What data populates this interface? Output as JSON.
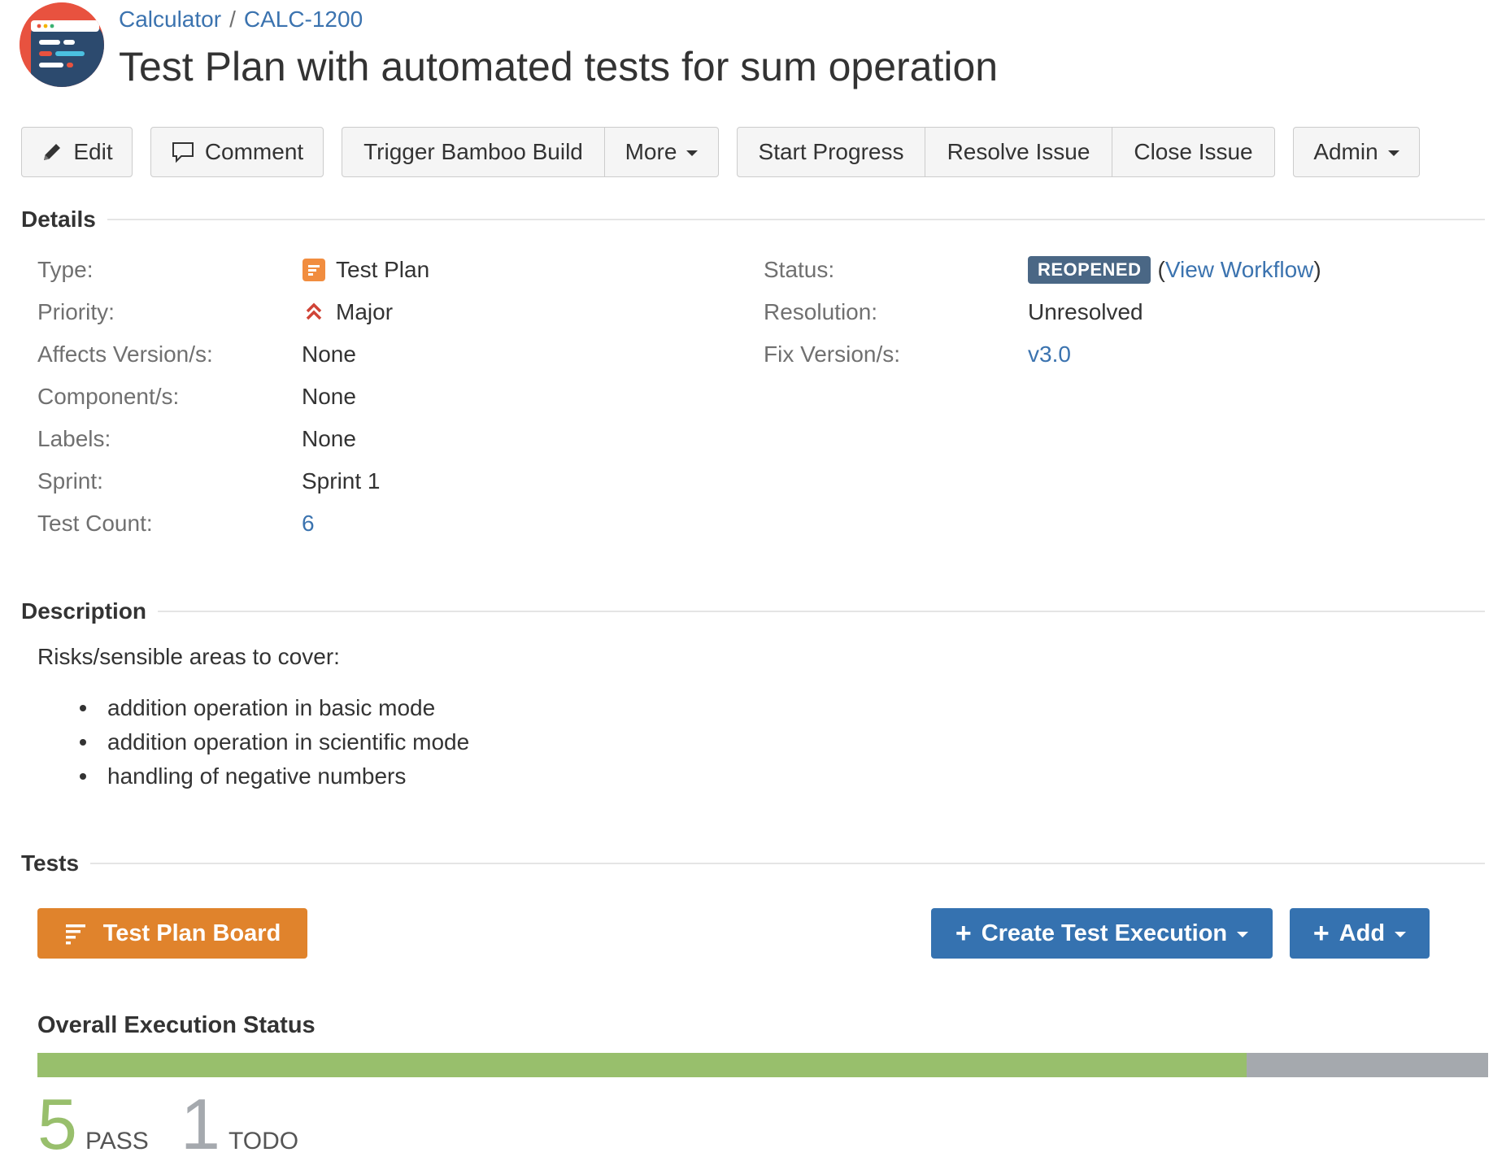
{
  "breadcrumb": {
    "project": "Calculator",
    "separator": "/",
    "issue_key": "CALC-1200"
  },
  "title": "Test Plan with automated tests for sum operation",
  "toolbar": {
    "edit": "Edit",
    "comment": "Comment",
    "trigger_bamboo": "Trigger Bamboo Build",
    "more": "More",
    "start_progress": "Start Progress",
    "resolve_issue": "Resolve Issue",
    "close_issue": "Close Issue",
    "admin": "Admin"
  },
  "details": {
    "heading": "Details",
    "type": {
      "label": "Type:",
      "value": "Test Plan"
    },
    "priority": {
      "label": "Priority:",
      "value": "Major"
    },
    "affects_versions": {
      "label": "Affects Version/s:",
      "value": "None"
    },
    "components": {
      "label": "Component/s:",
      "value": "None"
    },
    "labels": {
      "label": "Labels:",
      "value": "None"
    },
    "sprint": {
      "label": "Sprint:",
      "value": "Sprint 1"
    },
    "test_count": {
      "label": "Test Count:",
      "value": "6"
    },
    "status": {
      "label": "Status:",
      "value": "REOPENED",
      "open_paren": "(",
      "workflow_link": "View Workflow",
      "close_paren": ")"
    },
    "resolution": {
      "label": "Resolution:",
      "value": "Unresolved"
    },
    "fix_versions": {
      "label": "Fix Version/s:",
      "value": "v3.0"
    }
  },
  "description": {
    "heading": "Description",
    "intro": "Risks/sensible areas to cover:",
    "items": [
      "addition operation in basic mode",
      "addition operation in scientific mode",
      "handling of negative numbers"
    ]
  },
  "tests": {
    "heading": "Tests",
    "board_button": "Test Plan Board",
    "create_execution_button": "Create Test Execution",
    "add_button": "Add",
    "overall_title": "Overall Execution Status",
    "pass_count": "5",
    "pass_label": "PASS",
    "todo_count": "1",
    "todo_label": "TODO",
    "pass_fraction": 0.8333
  },
  "colors": {
    "link": "#3b73af",
    "badge_reopened": "#4a6785",
    "board_button": "#e0832c",
    "primary_button": "#3572b0",
    "pass": "#98bf6c",
    "todo": "#a5a9ae",
    "priority_major": "#d04437"
  },
  "icons": {
    "project_avatar": "calculator-project-avatar",
    "edit": "pencil-icon",
    "comment": "speech-bubble-icon",
    "type": "test-plan-icon",
    "priority": "priority-major-icon",
    "board": "test-plan-board-icon"
  }
}
